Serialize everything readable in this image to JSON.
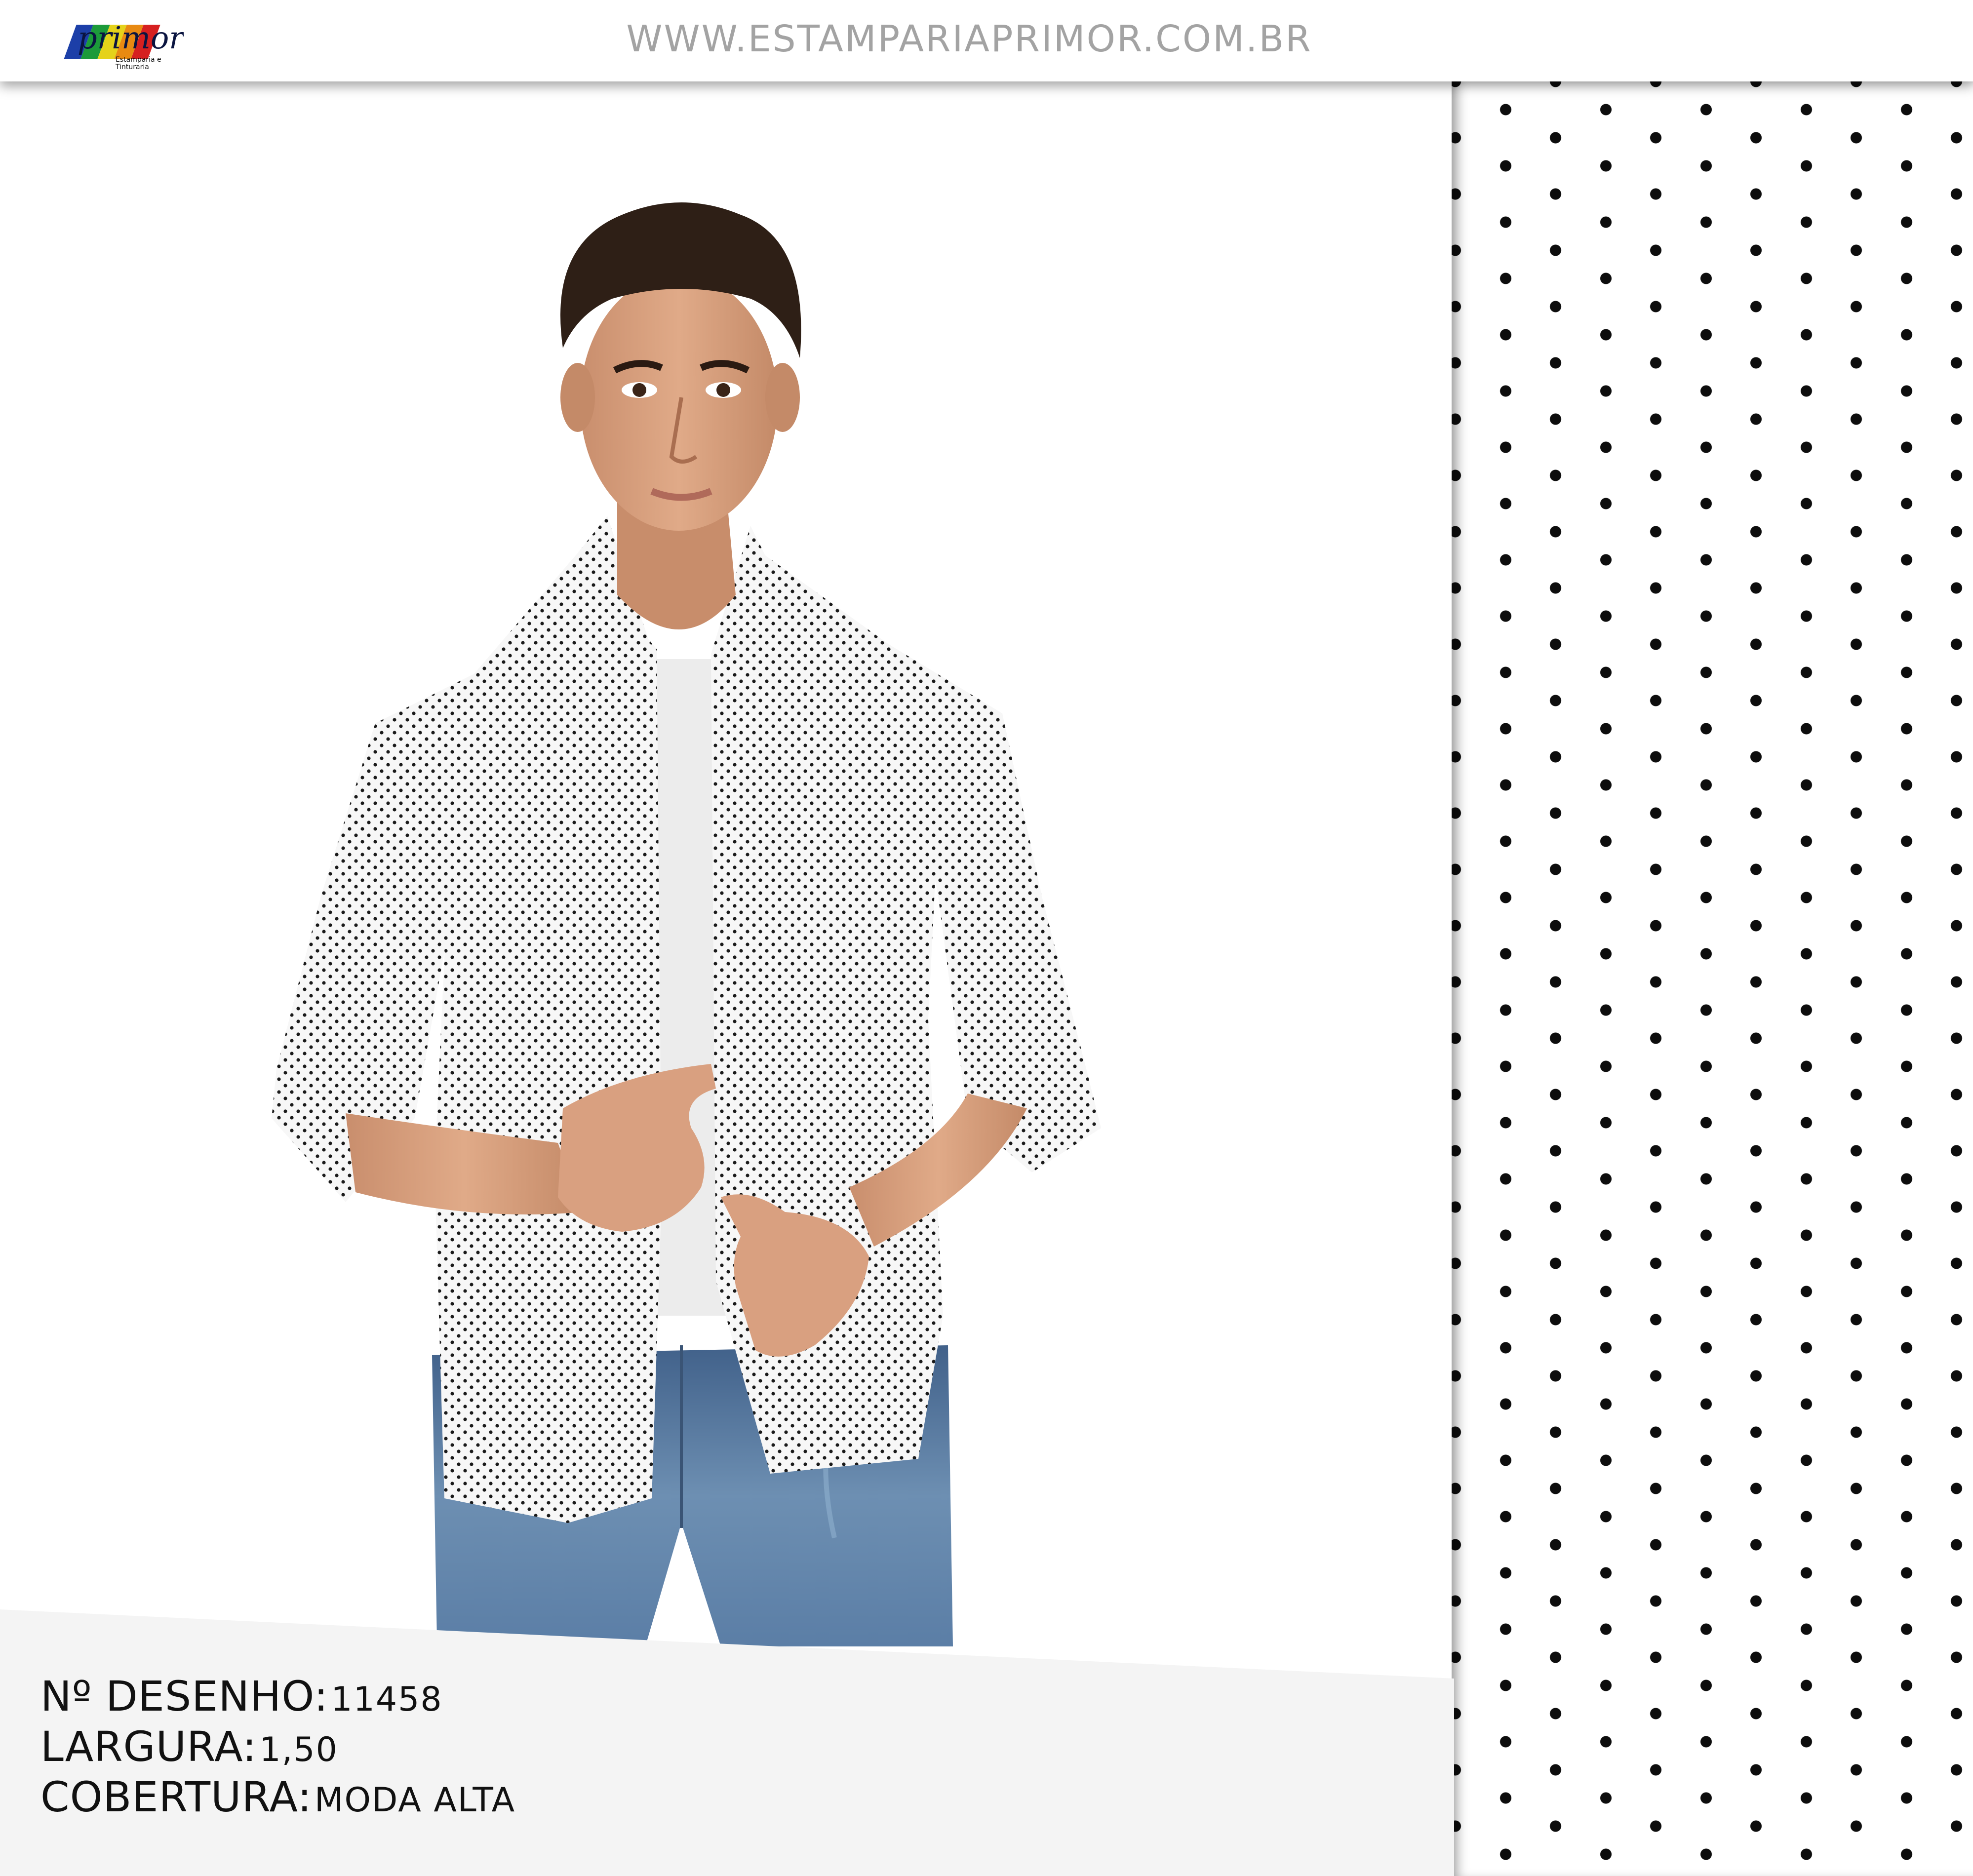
{
  "header": {
    "logo_text": "primor",
    "logo_subtext": "Estamparia e Tinturaria",
    "site_url": "WWW.ESTAMPARIAPRIMOR.COM.BR"
  },
  "colors": {
    "header_text": "#a3a3a3",
    "dot": "#0d0d0d",
    "info_band": "#f4f4f4",
    "logo_stripes": [
      "#1c3fa8",
      "#1c9a3a",
      "#e5d21a",
      "#e88a12",
      "#d62020"
    ]
  },
  "info": {
    "design_label": "Nº DESENHO:",
    "design_value": "11458",
    "width_label": "LARGURA:",
    "width_value": "1,50",
    "coverage_label": "COBERTURA:",
    "coverage_value": "MODA ALTA"
  },
  "photo": {
    "description_icon": "model-photo"
  },
  "swatch": {
    "pattern": "black-polka-dots-on-white"
  }
}
